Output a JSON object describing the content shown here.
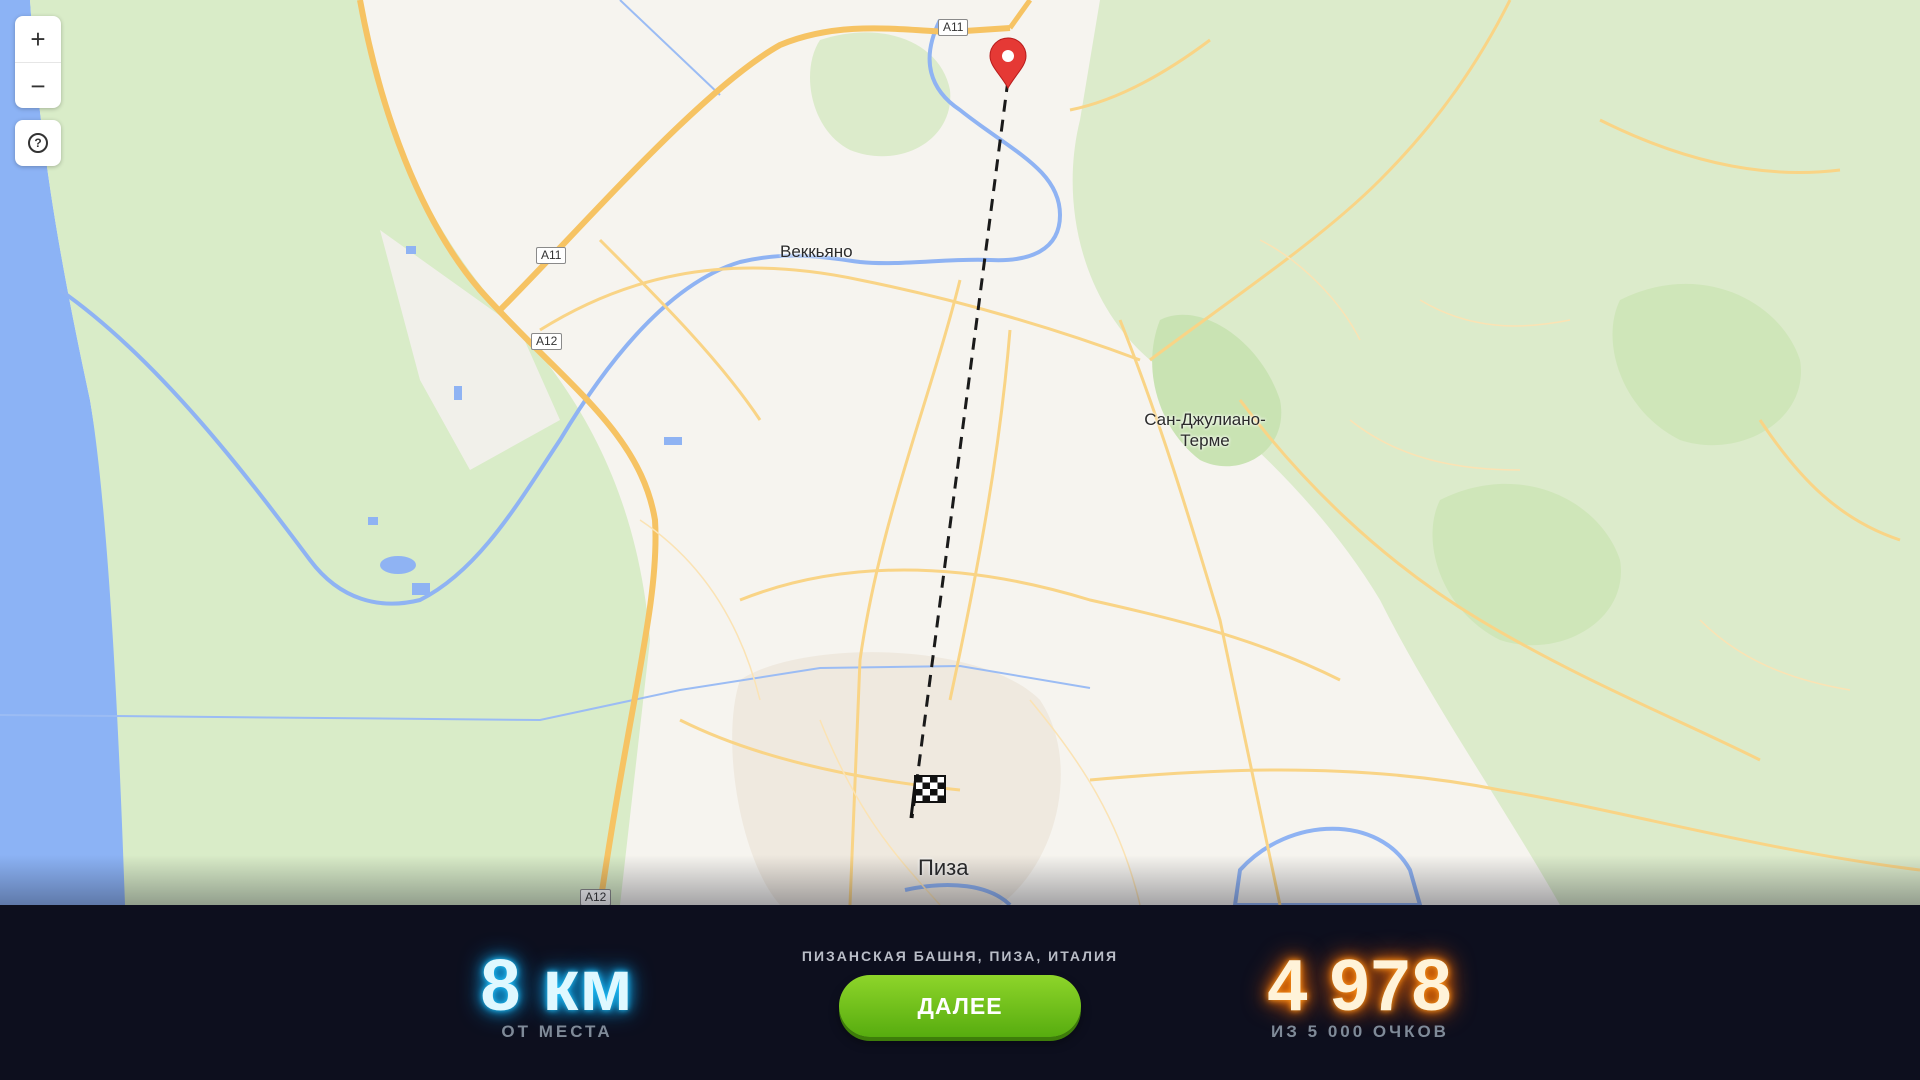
{
  "map": {
    "labels": {
      "vecchiano": "Веккьяно",
      "san_giuliano": "Сан-Джулиано-Терме",
      "pisa": "Пиза"
    },
    "shields": {
      "a11_top": "A11",
      "a11_mid": "A11",
      "a12_mid": "A12",
      "a12_bottom": "A12"
    }
  },
  "controls": {
    "zoom_in": "+",
    "zoom_out": "−",
    "help": "?"
  },
  "result": {
    "distance_value": "8 км",
    "distance_caption": "ОТ МЕСТА",
    "location_name": "ПИЗАНСКАЯ БАШНЯ, ПИЗА, ИТАЛИЯ",
    "next_button": "ДАЛЕЕ",
    "score_value": "4 978",
    "score_caption": "ИЗ 5 000 ОЧКОВ"
  },
  "colors": {
    "water": "#7ea8f0",
    "forest": "#d8ebc6",
    "road": "#f7cd72",
    "guess_marker": "#e53935",
    "next_button": "#6cc51b",
    "distance_glow": "#22c7ff",
    "score_glow": "#ff7a00"
  }
}
